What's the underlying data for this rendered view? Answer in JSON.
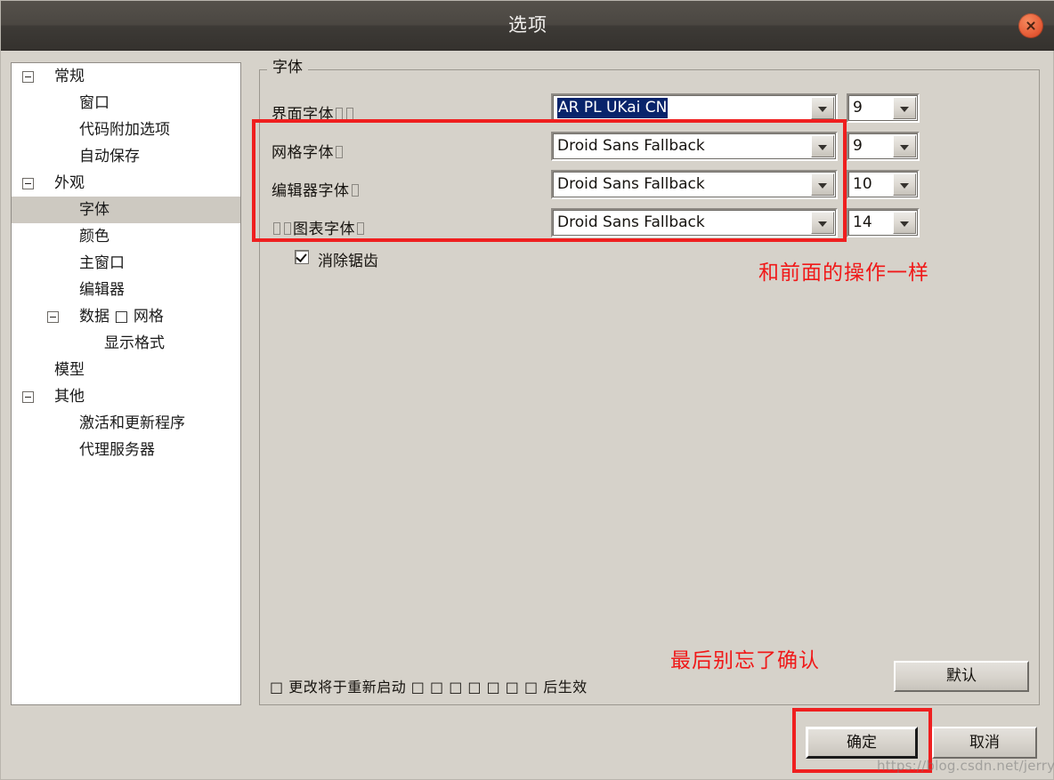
{
  "window": {
    "title": "选项",
    "close_icon": "close-icon"
  },
  "sidebar": {
    "items": [
      {
        "label": "常规",
        "level": 0,
        "expandable": true,
        "selected": false
      },
      {
        "label": "窗口",
        "level": 1,
        "expandable": false,
        "selected": false
      },
      {
        "label": "代码附加选项",
        "level": 1,
        "expandable": false,
        "selected": false
      },
      {
        "label": "自动保存",
        "level": 1,
        "expandable": false,
        "selected": false
      },
      {
        "label": "外观",
        "level": 0,
        "expandable": true,
        "selected": false
      },
      {
        "label": "字体",
        "level": 1,
        "expandable": false,
        "selected": true
      },
      {
        "label": "颜色",
        "level": 1,
        "expandable": false,
        "selected": false
      },
      {
        "label": "主窗口",
        "level": 1,
        "expandable": false,
        "selected": false
      },
      {
        "label": "编辑器",
        "level": 1,
        "expandable": false,
        "selected": false
      },
      {
        "label": "数据 □ 网格",
        "level": 1,
        "expandable": true,
        "selected": false
      },
      {
        "label": "显示格式",
        "level": 2,
        "expandable": false,
        "selected": false
      },
      {
        "label": "模型",
        "level": 0,
        "expandable": false,
        "selected": false
      },
      {
        "label": "其他",
        "level": 0,
        "expandable": true,
        "selected": false
      },
      {
        "label": "激活和更新程序",
        "level": 1,
        "expandable": false,
        "selected": false
      },
      {
        "label": "代理服务器",
        "level": 1,
        "expandable": false,
        "selected": false
      }
    ]
  },
  "fonts_group": {
    "legend": "字体",
    "rows": [
      {
        "label_prefix": "界面字体",
        "tofu_before": 0,
        "tofu_after": 2,
        "font_value": "AR PL UKai CN",
        "font_selected": true,
        "size_value": "9"
      },
      {
        "label_prefix": "网格字体",
        "tofu_before": 0,
        "tofu_after": 1,
        "font_value": "Droid Sans Fallback",
        "font_selected": false,
        "size_value": "9"
      },
      {
        "label_prefix": "编辑器字体",
        "tofu_before": 0,
        "tofu_after": 1,
        "font_value": "Droid Sans Fallback",
        "font_selected": false,
        "size_value": "10"
      },
      {
        "label_prefix": "图表字体",
        "tofu_before": 2,
        "tofu_after": 1,
        "font_value": "Droid Sans Fallback",
        "font_selected": false,
        "size_value": "14"
      }
    ],
    "antialias": {
      "label": "消除锯齿",
      "checked": true
    },
    "restart_note": "□ 更改将于重新启动 □ □ □ □ □ □ □ 后生效",
    "default_button": "默认"
  },
  "footer": {
    "ok_button": "确定",
    "cancel_button": "取消"
  },
  "annotations": {
    "note_fields": "和前面的操作一样",
    "note_confirm": "最后别忘了确认",
    "color": "#ef1f1f"
  },
  "watermark": {
    "text": "https://blog.csdn.net/jerrysong"
  }
}
